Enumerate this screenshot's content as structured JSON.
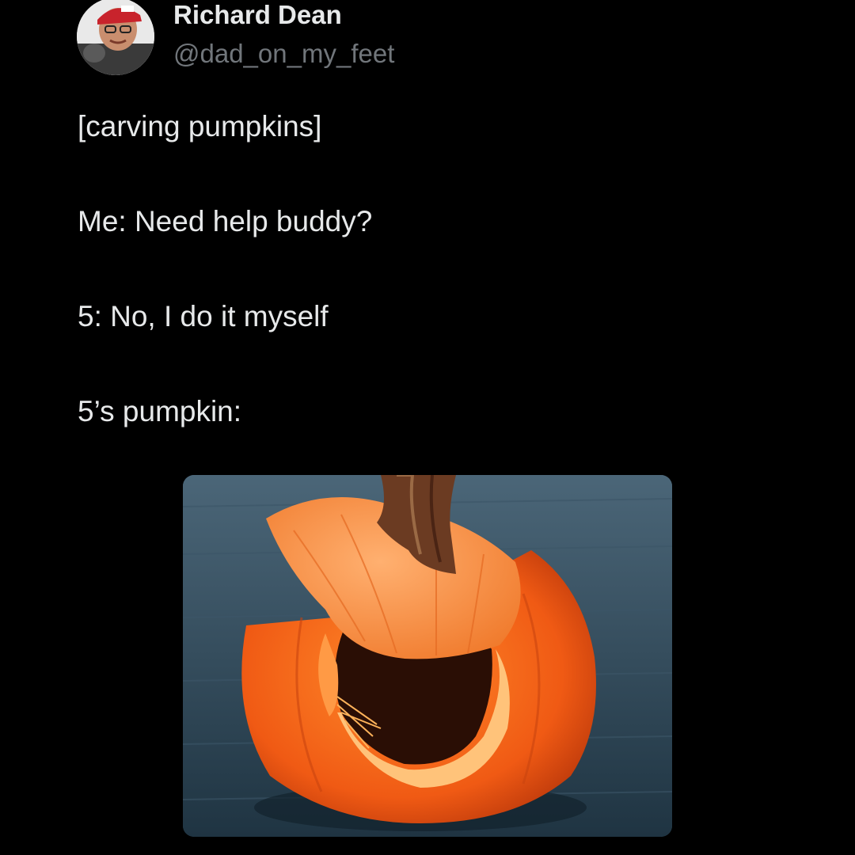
{
  "tweet": {
    "author": {
      "display_name": "Richard Dean",
      "handle": "@dad_on_my_feet"
    },
    "lines": [
      "[carving pumpkins]",
      "Me: Need help buddy?",
      "5: No, I do it myself",
      "5’s pumpkin:"
    ]
  },
  "colors": {
    "background": "#000000",
    "text": "#e7e9ea",
    "secondary_text": "#71767b",
    "pumpkin": "#f05a14",
    "tablecloth": "#2f4a5c"
  }
}
